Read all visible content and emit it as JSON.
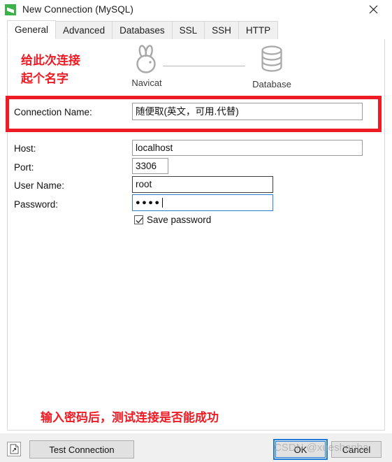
{
  "window": {
    "title": "New Connection (MySQL)",
    "app_icon": "navicat-green-icon",
    "close_icon": "close-icon"
  },
  "tabs": [
    {
      "label": "General",
      "active": true
    },
    {
      "label": "Advanced",
      "active": false
    },
    {
      "label": "Databases",
      "active": false
    },
    {
      "label": "SSL",
      "active": false
    },
    {
      "label": "SSH",
      "active": false
    },
    {
      "label": "HTTP",
      "active": false
    }
  ],
  "diagram": {
    "left_icon": "navicat-rabbit-icon",
    "left_label": "Navicat",
    "right_icon": "database-cylinder-icon",
    "right_label": "Database"
  },
  "annotations": {
    "top_line1": "给此次连接",
    "top_line2": "起个名字",
    "bottom": "输入密码后，测试连接是否能成功",
    "color": "#ee1b24"
  },
  "form": {
    "connection_name": {
      "label": "Connection Name:",
      "value": "随便取(英文，可用.代替)",
      "placeholder": ""
    },
    "host": {
      "label": "Host:",
      "value": "localhost",
      "placeholder": ""
    },
    "port": {
      "label": "Port:",
      "value": "3306",
      "placeholder": ""
    },
    "user_name": {
      "label": "User Name:",
      "value": "root",
      "placeholder": ""
    },
    "password": {
      "label": "Password:",
      "value": "●●●●",
      "placeholder": ""
    },
    "save_password": {
      "label": "Save password",
      "checked": true,
      "check_icon": "checkmark-icon"
    }
  },
  "footer": {
    "corner_icon": "document-arrow-icon",
    "test_connection_label": "Test Connection",
    "ok_label": "OK",
    "cancel_label": "Cancel"
  },
  "watermark": {
    "text": "CSDN @xueshanba"
  },
  "colors": {
    "accent_blue": "#2c7fd4",
    "annotation_red": "#ee1b24",
    "panel_bg": "#ffffff",
    "chrome_bg": "#f0f0f0"
  }
}
